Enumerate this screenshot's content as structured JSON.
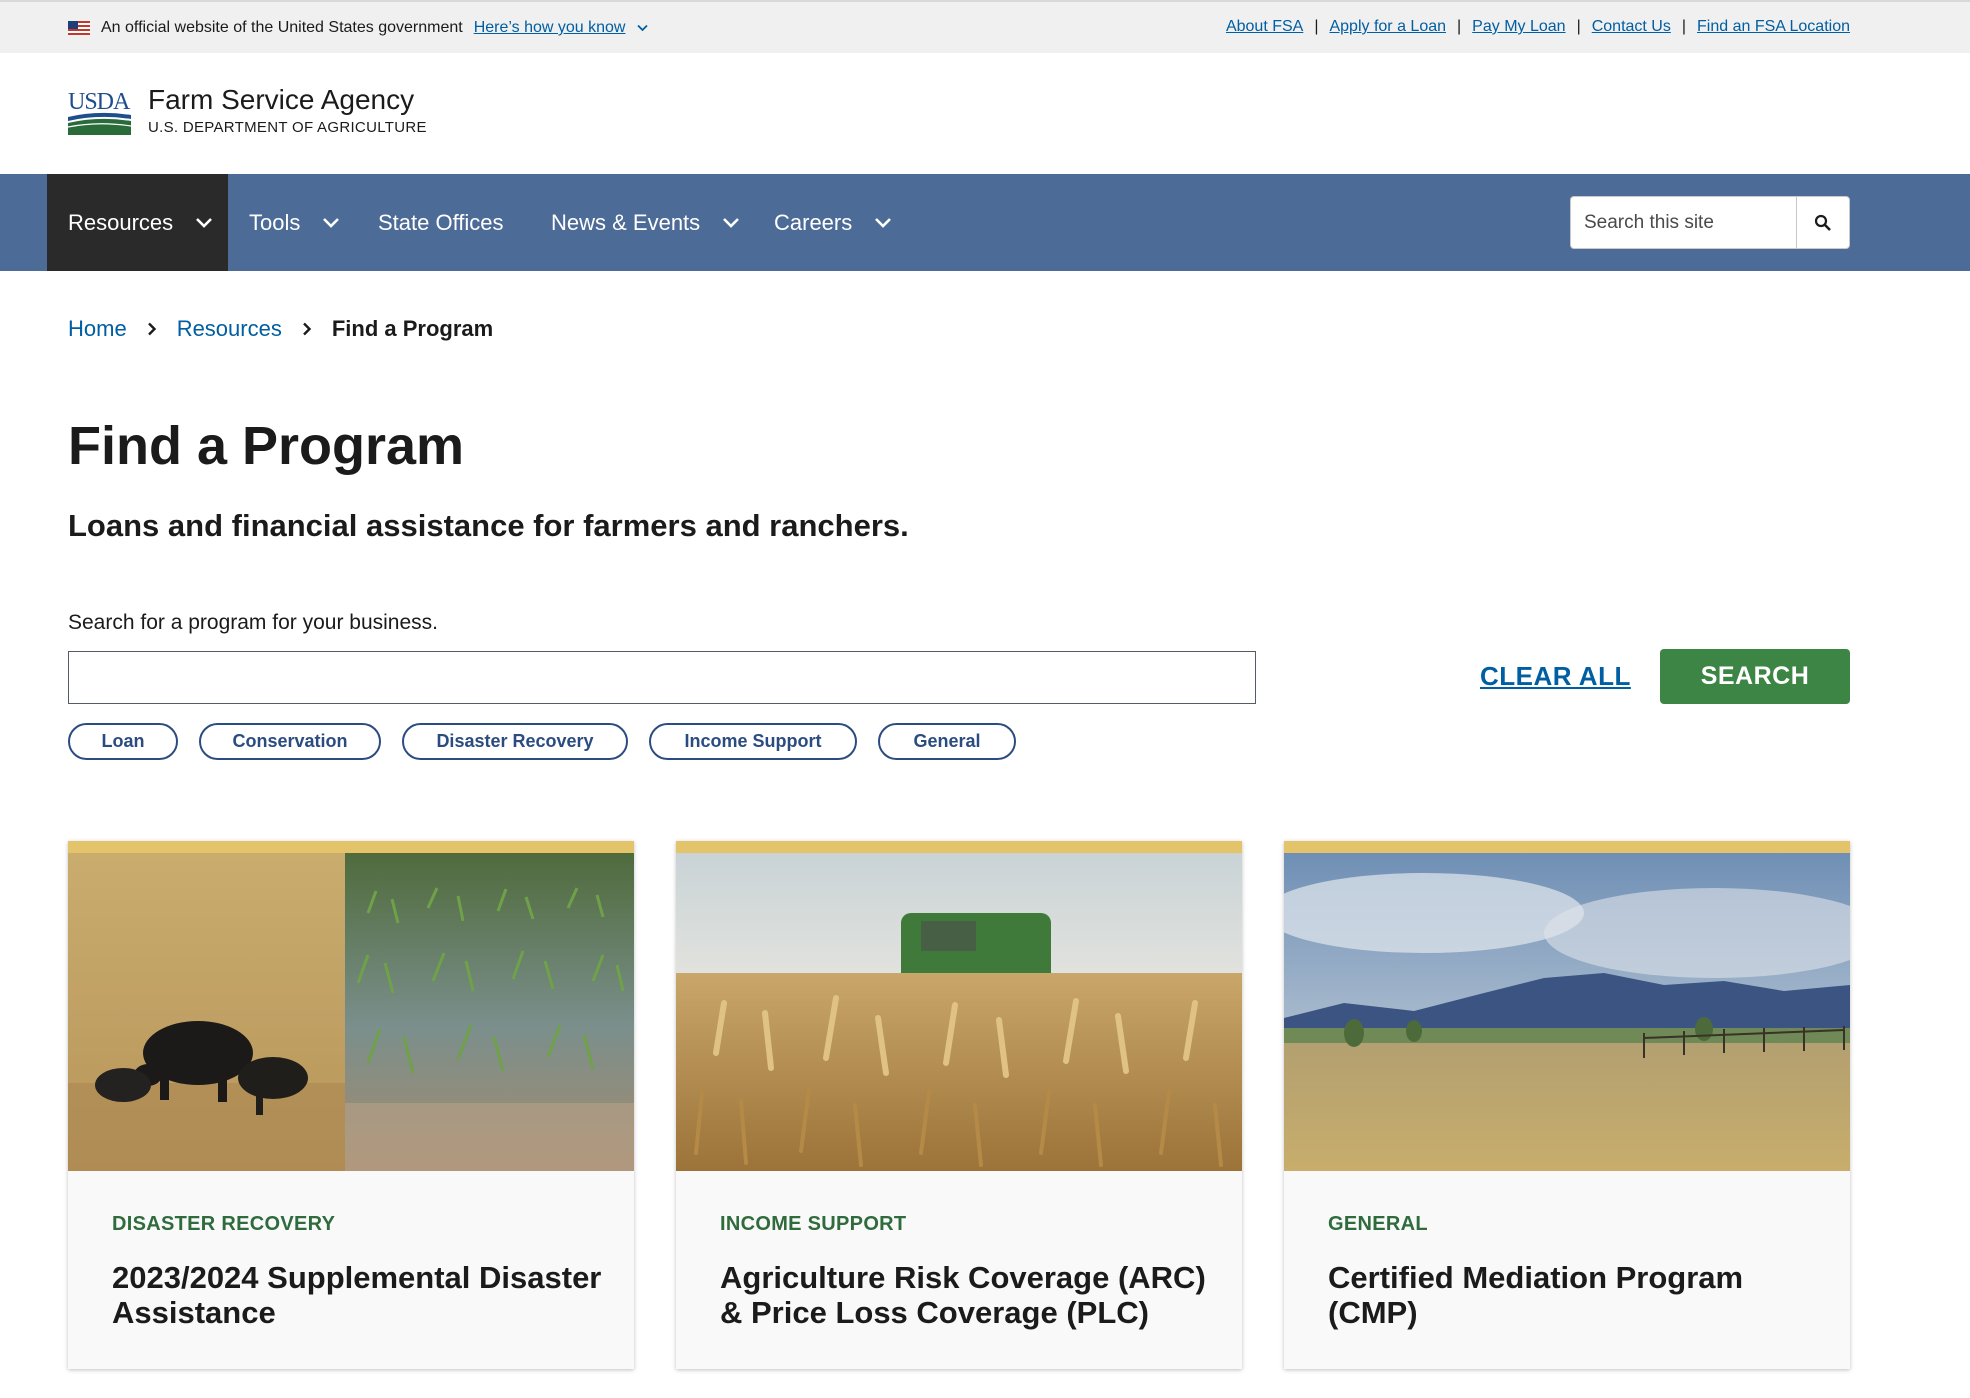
{
  "gov_banner": {
    "official_text": "An official website of the United States government",
    "how_link": "Here’s how you know",
    "links": [
      "About FSA",
      "Apply for a Loan",
      "Pay My Loan",
      "Contact Us",
      "Find an FSA Location"
    ]
  },
  "header": {
    "logo_text": "USDA",
    "agency_name": "Farm Service Agency",
    "department": "U.S. DEPARTMENT OF AGRICULTURE"
  },
  "nav": {
    "items": [
      "Resources",
      "Tools",
      "State Offices",
      "News & Events",
      "Careers"
    ],
    "search_placeholder": "Search this site"
  },
  "breadcrumb": {
    "home": "Home",
    "resources": "Resources",
    "current": "Find a Program"
  },
  "page": {
    "title": "Find a Program",
    "subtitle": "Loans and financial assistance for farmers and ranchers.",
    "search_label": "Search for a program for your business.",
    "search_value": "",
    "clear_all": "CLEAR ALL",
    "search_button": "SEARCH",
    "filter_tags": [
      "Loan",
      "Conservation",
      "Disaster Recovery",
      "Income Support",
      "General"
    ]
  },
  "cards": [
    {
      "category": "DISASTER RECOVERY",
      "title": "2023/2024 Supplemental Disaster Assistance"
    },
    {
      "category": "INCOME SUPPORT",
      "title": "Agriculture Risk Coverage (ARC) & Price Loss Coverage (PLC)"
    },
    {
      "category": "GENERAL",
      "title": "Certified Mediation Program (CMP)"
    }
  ],
  "colors": {
    "nav_bg": "#4c6b96",
    "nav_active": "#2a2a2a",
    "link": "#005ea2",
    "search_button": "#3c8544",
    "card_accent": "#e3c46a",
    "category_text": "#2f6b3c",
    "tag_border": "#2b4c80"
  }
}
